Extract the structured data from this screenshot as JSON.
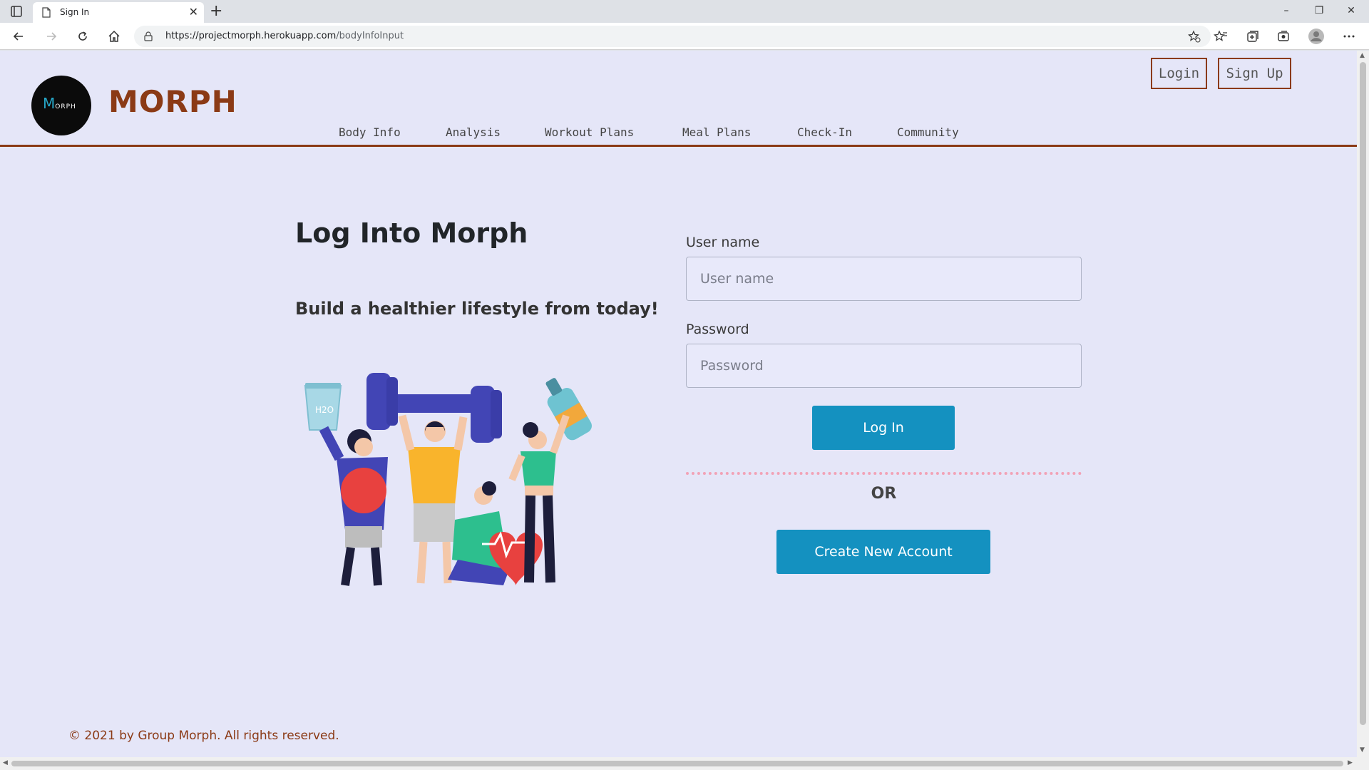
{
  "browser": {
    "tab_title": "Sign In",
    "url_host": "https://projectmorph.herokuapp.com",
    "url_path": "/bodyInfoInput"
  },
  "site": {
    "logo_text_big": "M",
    "logo_text_small": "ORPH",
    "title": "MORPH",
    "header_buttons": {
      "login": "Login",
      "signup": "Sign Up"
    },
    "nav": [
      "Body Info",
      "Analysis",
      "Workout Plans",
      "Meal Plans",
      "Check-In",
      "Community"
    ]
  },
  "main": {
    "heading": "Log Into Morph",
    "tagline": "Build a healthier lifestyle from today!",
    "illustration_water_label": "H2O",
    "form": {
      "username_label": "User name",
      "username_placeholder": "User name",
      "username_value": "",
      "password_label": "Password",
      "password_placeholder": "Password",
      "password_value": "",
      "login_button": "Log In",
      "or_text": "OR",
      "create_account_button": "Create New Account"
    }
  },
  "footer": {
    "text": "© 2021 by Group Morph. All rights reserved."
  },
  "colors": {
    "brand": "#8b3a16",
    "page_bg": "#e5e6f8",
    "button_blue": "#1491c0",
    "divider_pink": "#f2a2b6"
  },
  "icons": [
    "tab-actions-icon",
    "page-favicon-icon",
    "close-icon",
    "plus-icon",
    "minimize-icon",
    "restore-icon",
    "window-close-icon",
    "back-arrow-icon",
    "forward-arrow-icon",
    "reload-icon",
    "home-icon",
    "lock-icon",
    "add-favorite-icon",
    "favorites-icon",
    "collections-icon",
    "browser-essentials-icon",
    "profile-avatar-icon",
    "more-menu-icon"
  ]
}
